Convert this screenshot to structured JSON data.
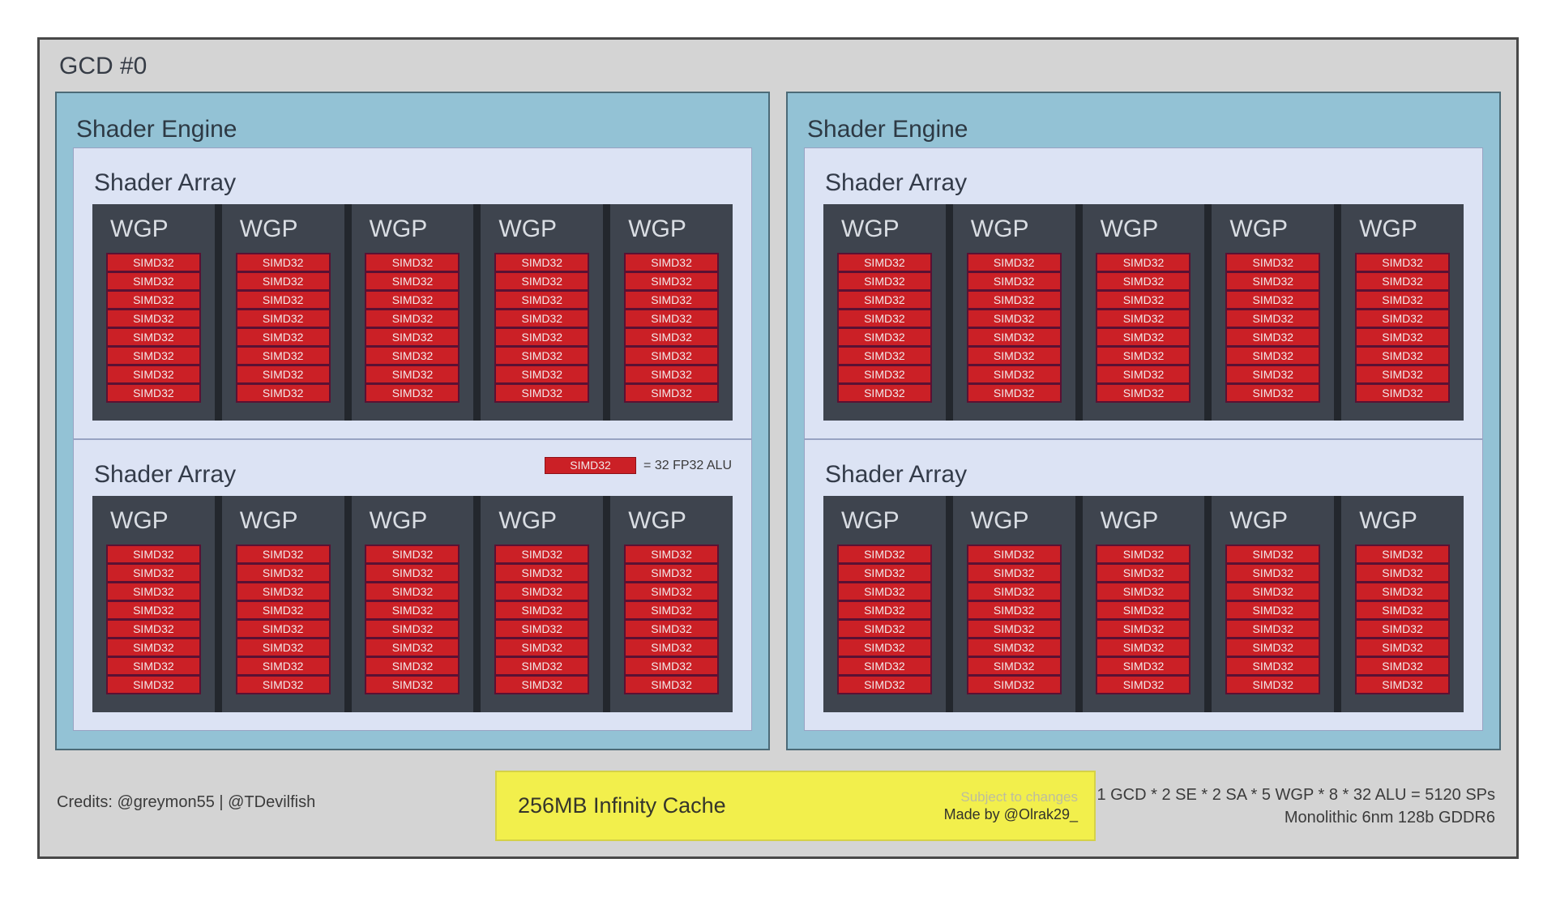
{
  "title": "GCD #0",
  "engine_label": "Shader Engine",
  "array_label": "Shader Array",
  "wgp_label": "WGP",
  "simd_label": "SIMD32",
  "structure": {
    "engines": 2,
    "arrays_per_engine": 2,
    "wgps_per_array": 5,
    "simds_per_wgp": 8
  },
  "legend": {
    "engine_index": 0,
    "array_index": 1,
    "chip": "SIMD32",
    "equals": "= 32 FP32 ALU"
  },
  "footer": {
    "credits": "Credits:  @greymon55 | @TDevilfish",
    "cache_label": "256MB Infinity Cache",
    "subject_note": "Subject to changes",
    "made_by": "Made by @Olrak29_",
    "spec_line1": "1 GCD * 2 SE * 2 SA * 5 WGP * 8 * 32 ALU = 5120 SPs",
    "spec_line2": "Monolithic 6nm 128b GDDR6"
  },
  "colors": {
    "die_bg": "#d4d4d4",
    "engine_bg": "#93c2d5",
    "array_bg": "#dce3f4",
    "wgp_bg": "#3e444e",
    "simd_red": "#cb2026",
    "simd_border": "#5a1133",
    "cache_yellow": "#f2ef4c"
  }
}
